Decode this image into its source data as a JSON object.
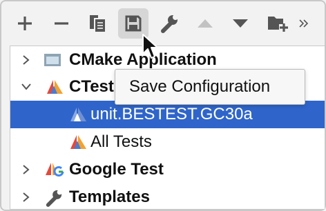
{
  "toolbar": {
    "buttons": [
      {
        "name": "add-button",
        "icon": "plus-icon"
      },
      {
        "name": "remove-button",
        "icon": "minus-icon"
      },
      {
        "name": "copy-configuration-button",
        "icon": "copy-icon"
      },
      {
        "name": "save-configuration-button",
        "icon": "save-icon",
        "pressed": true
      },
      {
        "name": "edit-templates-button",
        "icon": "wrench-icon"
      },
      {
        "name": "move-up-button",
        "icon": "triangle-up-icon",
        "enabled": false
      },
      {
        "name": "move-down-button",
        "icon": "triangle-down-icon"
      },
      {
        "name": "new-folder-button",
        "icon": "folder-plus-icon"
      },
      {
        "name": "more-actions-button",
        "icon": "double-chevron-right-icon"
      }
    ]
  },
  "tree": {
    "items": [
      {
        "label": "CMake Application",
        "icon": "cmake-application-icon",
        "state": "collapsed",
        "bold": true
      },
      {
        "label": "CTest",
        "icon": "ctest-icon",
        "state": "expanded",
        "bold": true
      },
      {
        "label": "unit.BESTEST.GC30a",
        "icon": "ctest-icon",
        "selected": true
      },
      {
        "label": "All Tests",
        "icon": "ctest-icon"
      },
      {
        "label": "Google Test",
        "icon": "google-test-icon",
        "state": "collapsed",
        "bold": true
      },
      {
        "label": "Templates",
        "icon": "wrench-icon",
        "state": "collapsed",
        "bold": true
      }
    ]
  },
  "tooltip": {
    "text": "Save Configuration"
  },
  "colors": {
    "selection": "#2f65ca",
    "icon": "#555555",
    "icon_disabled": "#c2c2c2",
    "ctest_red": "#e5493a",
    "ctest_orange": "#f0a232"
  }
}
